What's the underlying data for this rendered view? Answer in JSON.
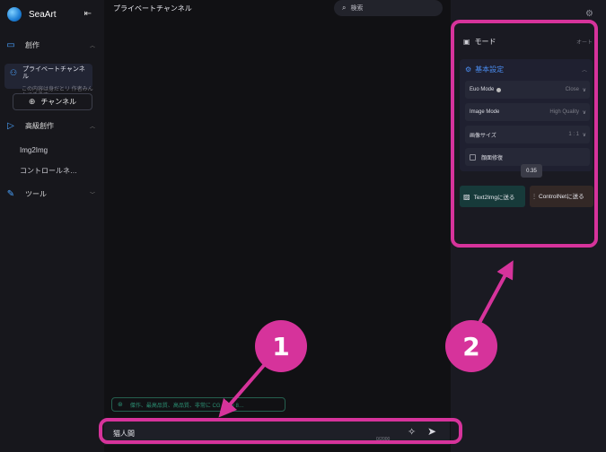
{
  "sidebar": {
    "brand": "SeaArt",
    "create_label": "創作",
    "channel_name": "プライベートチャンネル",
    "channel_sub": "この内容は身だとリ 作者みんなできます",
    "add_channel_label": "チャンネル",
    "advanced_label": "高級創作",
    "img2img_label": "Img2Img",
    "controlnet_label": "コントロールネ…",
    "tools_label": "ツール"
  },
  "main": {
    "title": "プライベートチャンネル",
    "search_placeholder": "検索",
    "tags_text": "傑作、最高品質、高品質、非常に CG Unity 8…",
    "prompt_text": "猫人間",
    "counter": "0/2000"
  },
  "right": {
    "mode_label": "モード",
    "mode_value": "オート",
    "basic_label": "基本設定",
    "options": [
      {
        "label": "Euo Mode",
        "value": "Close"
      },
      {
        "label": "Image Mode",
        "value": "High Quality"
      },
      {
        "label": "画像サイズ",
        "value": "1 : 1"
      }
    ],
    "face_fix_label": "顔面修復",
    "tooltip": "0.35",
    "text2img_button": "Text2Imgに送る",
    "controlnet_button": "ControlNetに送る"
  },
  "annotations": {
    "marker1": "1",
    "marker2": "2",
    "highlight_color": "#d6339b"
  }
}
